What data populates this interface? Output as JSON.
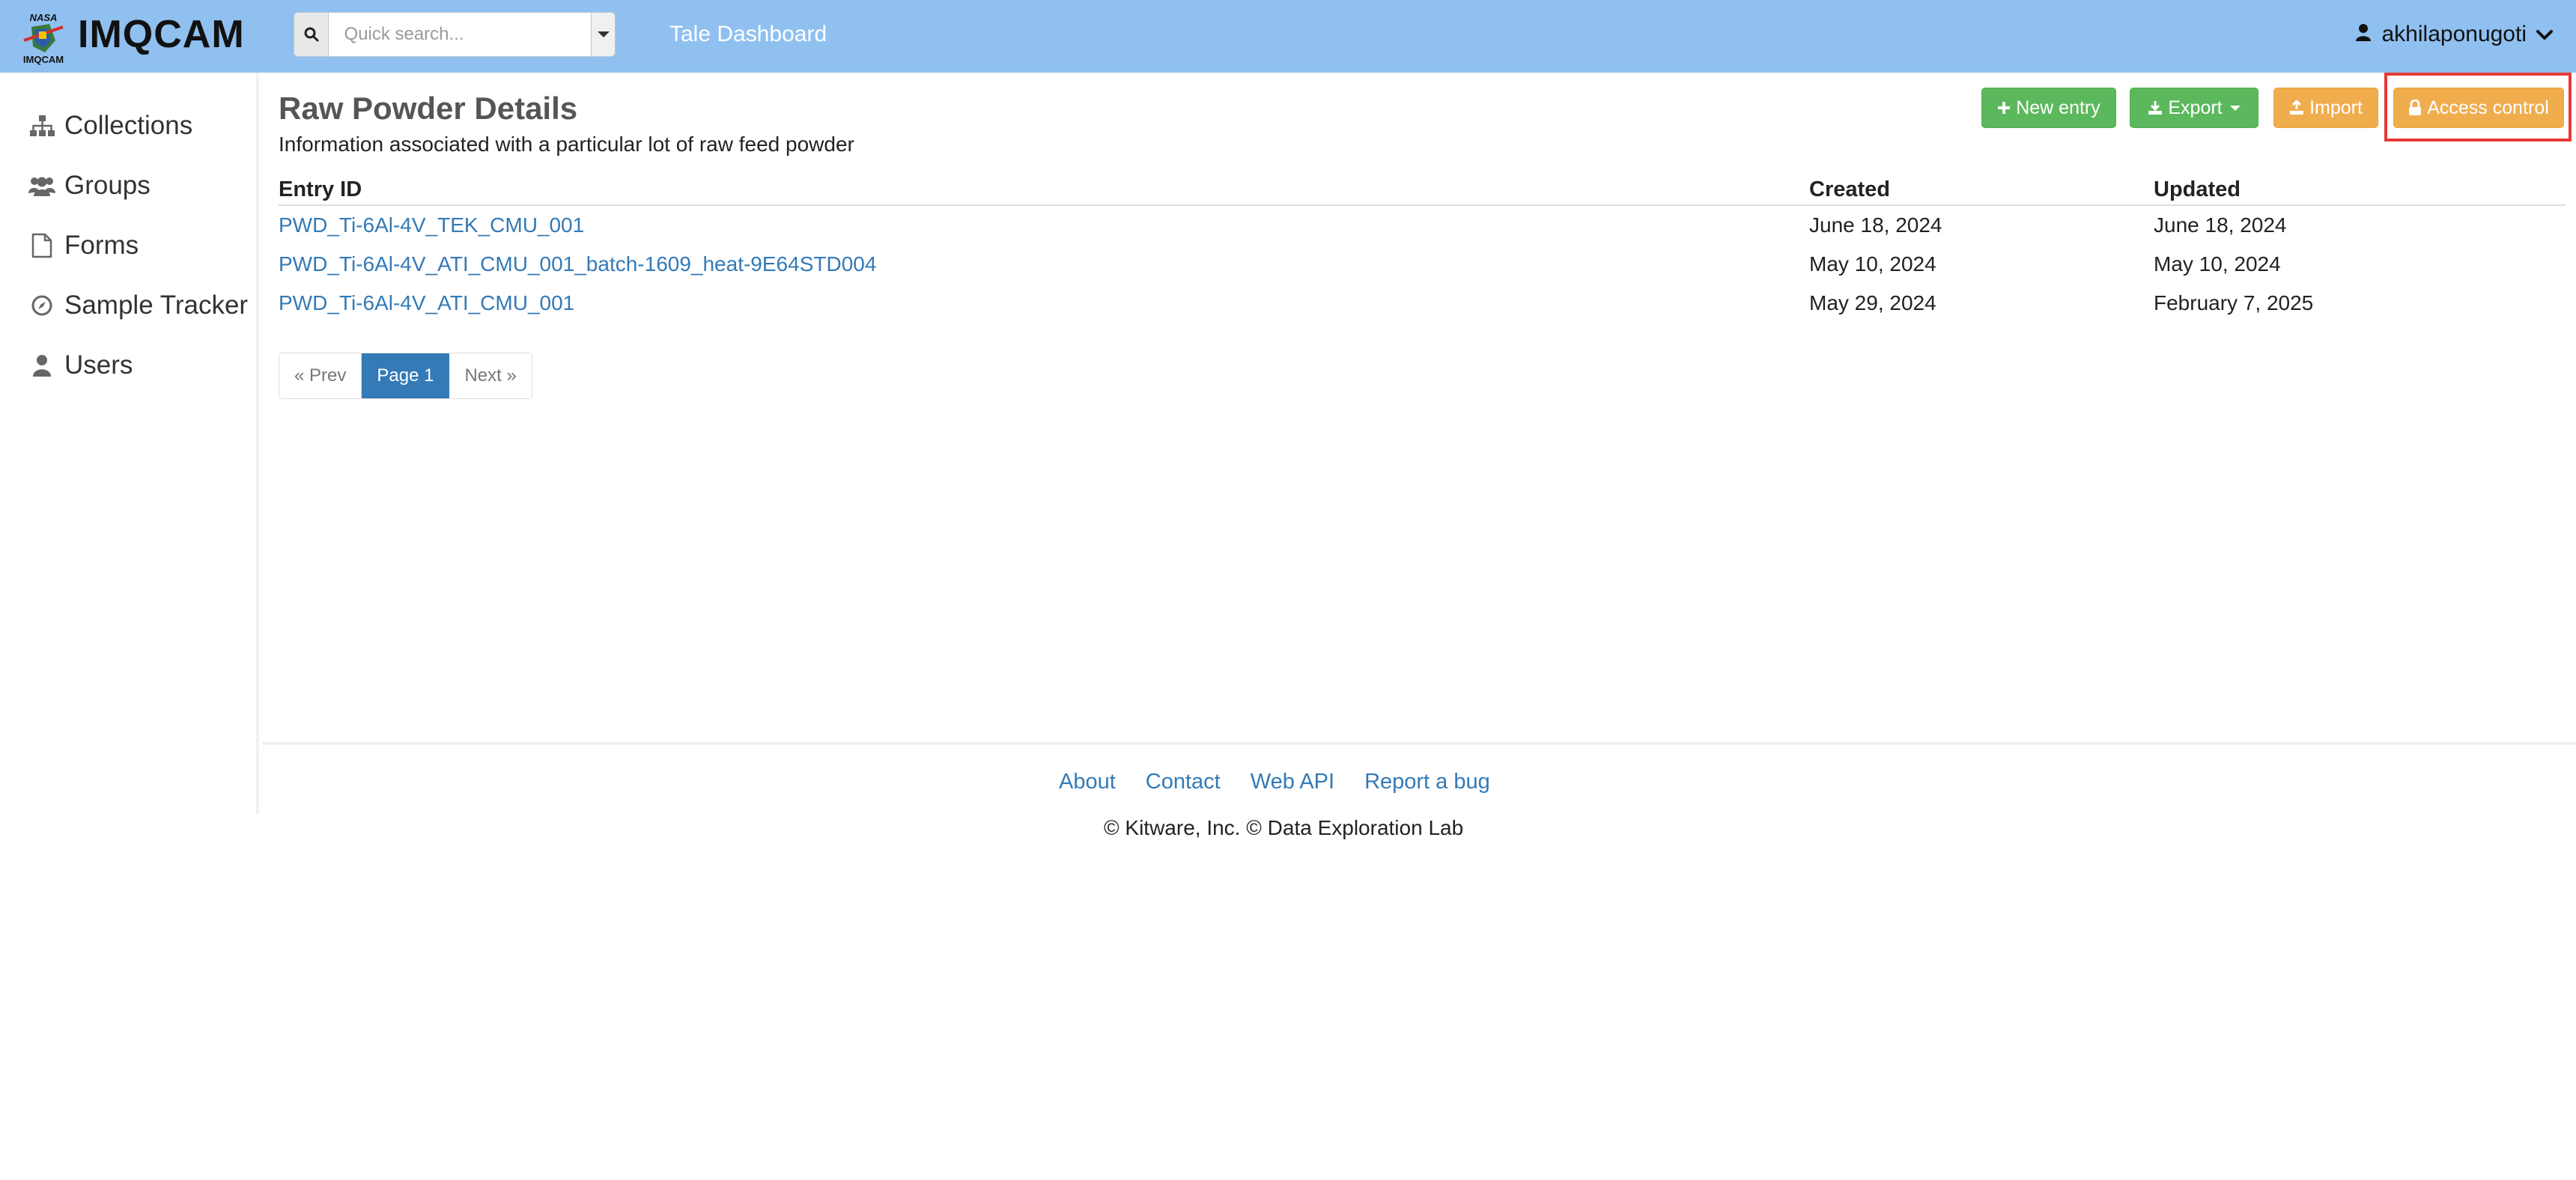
{
  "header": {
    "brand": "IMQCAM",
    "logo_text_top": "NASA",
    "logo_text_bottom": "IMQCAM",
    "search_placeholder": "Quick search...",
    "tale_link": "Tale Dashboard",
    "username": "akhilaponugoti"
  },
  "sidebar": {
    "items": [
      {
        "label": "Collections",
        "icon": "sitemap-icon"
      },
      {
        "label": "Groups",
        "icon": "users-icon"
      },
      {
        "label": "Forms",
        "icon": "file-icon"
      },
      {
        "label": "Sample Tracker",
        "icon": "compass-icon"
      },
      {
        "label": "Users",
        "icon": "user-icon"
      }
    ]
  },
  "main": {
    "title": "Raw Powder Details",
    "description": "Information associated with a particular lot of raw feed powder",
    "actions": {
      "new_entry": "New entry",
      "export": "Export",
      "import": "Import",
      "access_control": "Access control"
    },
    "table": {
      "headers": {
        "id": "Entry ID",
        "created": "Created",
        "updated": "Updated"
      },
      "rows": [
        {
          "id": "PWD_Ti-6Al-4V_TEK_CMU_001",
          "created": "June 18, 2024",
          "updated": "June 18, 2024"
        },
        {
          "id": "PWD_Ti-6Al-4V_ATI_CMU_001_batch-1609_heat-9E64STD004",
          "created": "May 10, 2024",
          "updated": "May 10, 2024"
        },
        {
          "id": "PWD_Ti-6Al-4V_ATI_CMU_001",
          "created": "May 29, 2024",
          "updated": "February 7, 2025"
        }
      ]
    },
    "pager": {
      "prev": "« Prev",
      "current": "Page 1",
      "next": "Next »"
    }
  },
  "footer": {
    "links": [
      "About",
      "Contact",
      "Web API",
      "Report a bug"
    ],
    "copyright": "© Kitware, Inc. © Data Exploration Lab"
  },
  "colors": {
    "topbar": "#8fc0f0",
    "green": "#5cb85c",
    "orange": "#f0ad4e",
    "link": "#337ab7",
    "highlight": "#e53935"
  }
}
